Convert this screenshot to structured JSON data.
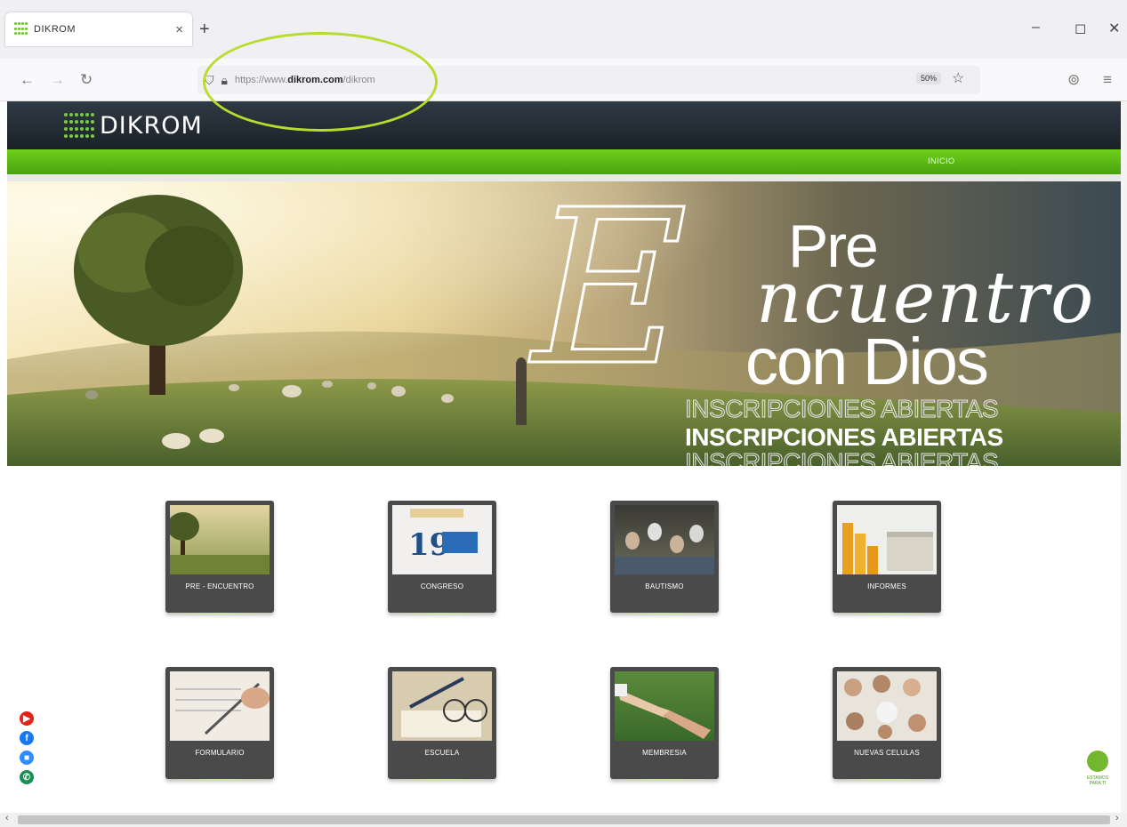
{
  "browser": {
    "tab_title": "DIKROM",
    "tab_close": "×",
    "new_tab": "+",
    "url_prefix": "https://www.",
    "url_domain": "dikrom.com",
    "url_path": "/dikrom",
    "zoom": "50%",
    "window_minimize": "–",
    "window_restore": "◻",
    "window_close": "✕"
  },
  "site": {
    "logo_text": "DIKROM",
    "menu": {
      "inicio": "INICIO"
    }
  },
  "hero": {
    "line_pre": "Pre",
    "line_encuentro": "ncuentro",
    "line_con_dios": "con Dios",
    "inscripciones": "INSCRIPCIONES ABIERTAS"
  },
  "tiles": [
    {
      "label": "PRE - ENCUENTRO"
    },
    {
      "label": "CONGRESO"
    },
    {
      "label": "BAUTISMO"
    },
    {
      "label": "INFORMES"
    },
    {
      "label": "FORMULARIO"
    },
    {
      "label": "ESCUELA"
    },
    {
      "label": "MEMBRESIA"
    },
    {
      "label": "NUEVAS CELULAS"
    }
  ],
  "social": [
    {
      "name": "youtube",
      "color": "#e62117"
    },
    {
      "name": "facebook",
      "color": "#1877f2"
    },
    {
      "name": "zoom",
      "color": "#2d8cff"
    },
    {
      "name": "whatsapp",
      "color": "#1a8f54"
    }
  ],
  "support": {
    "label_line1": "ESTAMOS",
    "label_line2": "PARA TI"
  },
  "colors": {
    "brand_green": "#6fd11a",
    "header_dark": "#1a2229",
    "tile_bg": "#4a4a4a"
  },
  "icons": [
    "back-icon",
    "forward-icon",
    "reload-icon",
    "shield-icon",
    "lock-icon",
    "star-icon",
    "pocket-icon",
    "menu-icon"
  ]
}
